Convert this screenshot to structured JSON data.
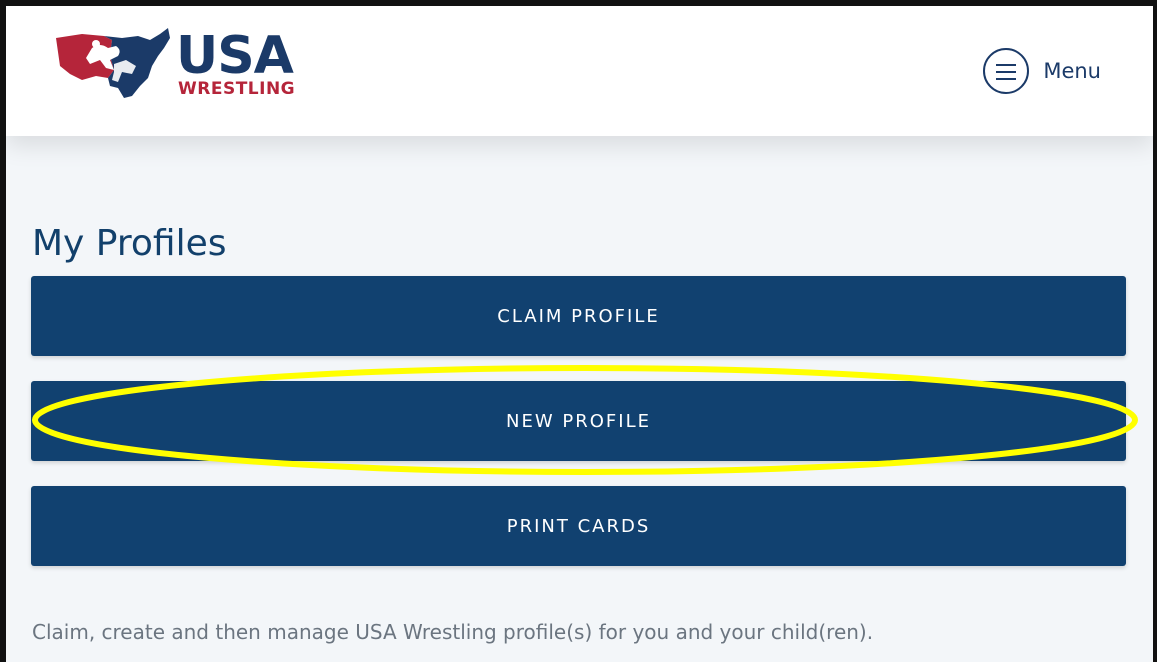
{
  "header": {
    "logo": {
      "primary": "USA",
      "secondary": "WRESTLING",
      "icon": "usa-map-wrestlers-logo"
    },
    "menu": {
      "icon": "hamburger-menu-icon",
      "label": "Menu"
    }
  },
  "main": {
    "title": "My Profiles",
    "buttons": [
      {
        "label": "CLAIM PROFILE"
      },
      {
        "label": "NEW PROFILE",
        "highlighted": true
      },
      {
        "label": "PRINT CARDS"
      }
    ],
    "description": "Claim, create and then manage USA Wrestling profile(s) for you and your child(ren)."
  },
  "colors": {
    "brand_navy": "#1b3a68",
    "brand_red": "#b5253a",
    "button_bg": "#114170",
    "page_bg": "#f3f6f9",
    "highlight": "#ffff00"
  }
}
